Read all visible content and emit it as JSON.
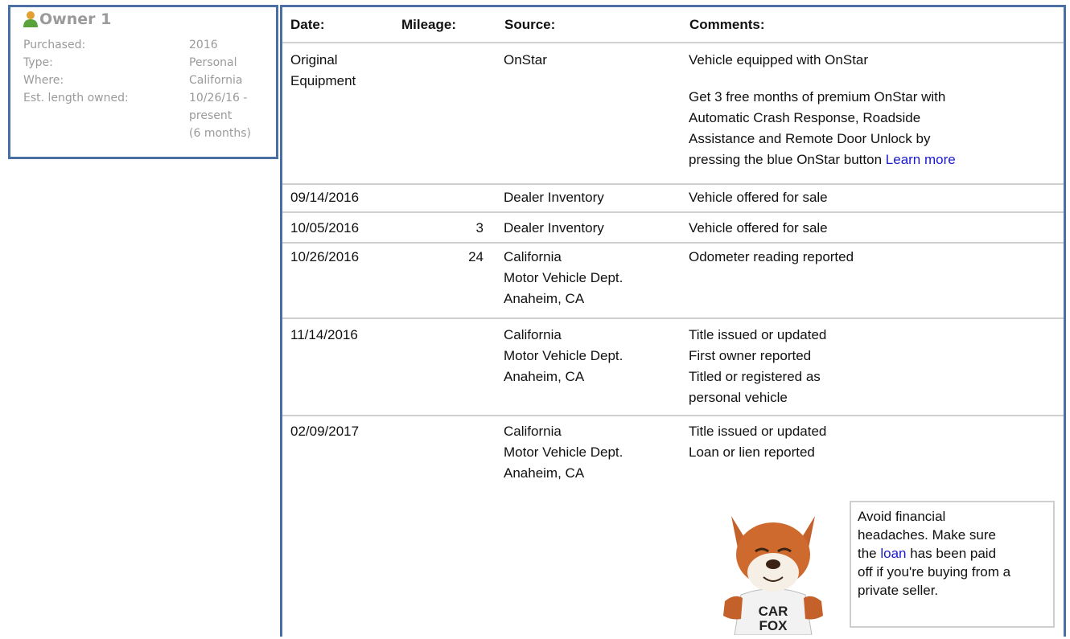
{
  "owner": {
    "title": "Owner 1",
    "rows": [
      {
        "label": "Purchased:",
        "value": [
          "2016"
        ]
      },
      {
        "label": "Type:",
        "value": [
          "Personal"
        ]
      },
      {
        "label": "Where:",
        "value": [
          "California"
        ]
      },
      {
        "label": "Est. length owned:",
        "value": [
          "10/26/16 -",
          "present",
          "(6 months)"
        ]
      }
    ]
  },
  "history": {
    "headers": {
      "date": "Date:",
      "mileage": "Mileage:",
      "source": "Source:",
      "comments": "Comments:"
    },
    "rows": [
      {
        "date": [
          "Original",
          "Equipment"
        ],
        "mileage": "",
        "source": [
          "OnStar"
        ],
        "comments": [
          "Vehicle equipped with OnStar"
        ],
        "extra": [
          "Get 3 free months of premium OnStar with",
          "Automatic Crash Response, Roadside",
          "Assistance and Remote Door Unlock by",
          "pressing the blue OnStar button"
        ],
        "link": "Learn more"
      },
      {
        "date": [
          "09/14/2016"
        ],
        "mileage": "",
        "source": [
          "Dealer Inventory"
        ],
        "comments": [
          "Vehicle offered for sale"
        ]
      },
      {
        "date": [
          "10/05/2016"
        ],
        "mileage": "3",
        "source": [
          "Dealer Inventory"
        ],
        "comments": [
          "Vehicle offered for sale"
        ]
      },
      {
        "date": [
          "10/26/2016"
        ],
        "mileage": "24",
        "source": [
          "California",
          "Motor Vehicle Dept.",
          "Anaheim, CA"
        ],
        "comments": [
          "Odometer reading reported"
        ]
      },
      {
        "date": [
          "11/14/2016"
        ],
        "mileage": "",
        "source": [
          "California",
          "Motor Vehicle Dept.",
          "Anaheim, CA"
        ],
        "comments": [
          "Title issued or updated",
          "First owner reported",
          "Titled or registered as",
          "personal vehicle"
        ]
      },
      {
        "date": [
          "02/09/2017"
        ],
        "mileage": "",
        "source": [
          "California",
          "Motor Vehicle Dept.",
          "Anaheim, CA"
        ],
        "comments": [
          "Title issued or updated",
          "Loan or lien reported"
        ]
      }
    ]
  },
  "tip": {
    "lines_before": [
      "Avoid financial",
      "headaches. Make sure"
    ],
    "the": "the ",
    "loan_link": "loan",
    "after_link": " has been paid",
    "lines_after": [
      "off if you're buying from a",
      "private seller."
    ]
  },
  "mascot": {
    "shirt_line1": "CAR",
    "shirt_line2": "FOX"
  },
  "colors": {
    "accent": "#4a6fa5",
    "link": "#1a1acf",
    "muted": "#9a9a9a"
  }
}
